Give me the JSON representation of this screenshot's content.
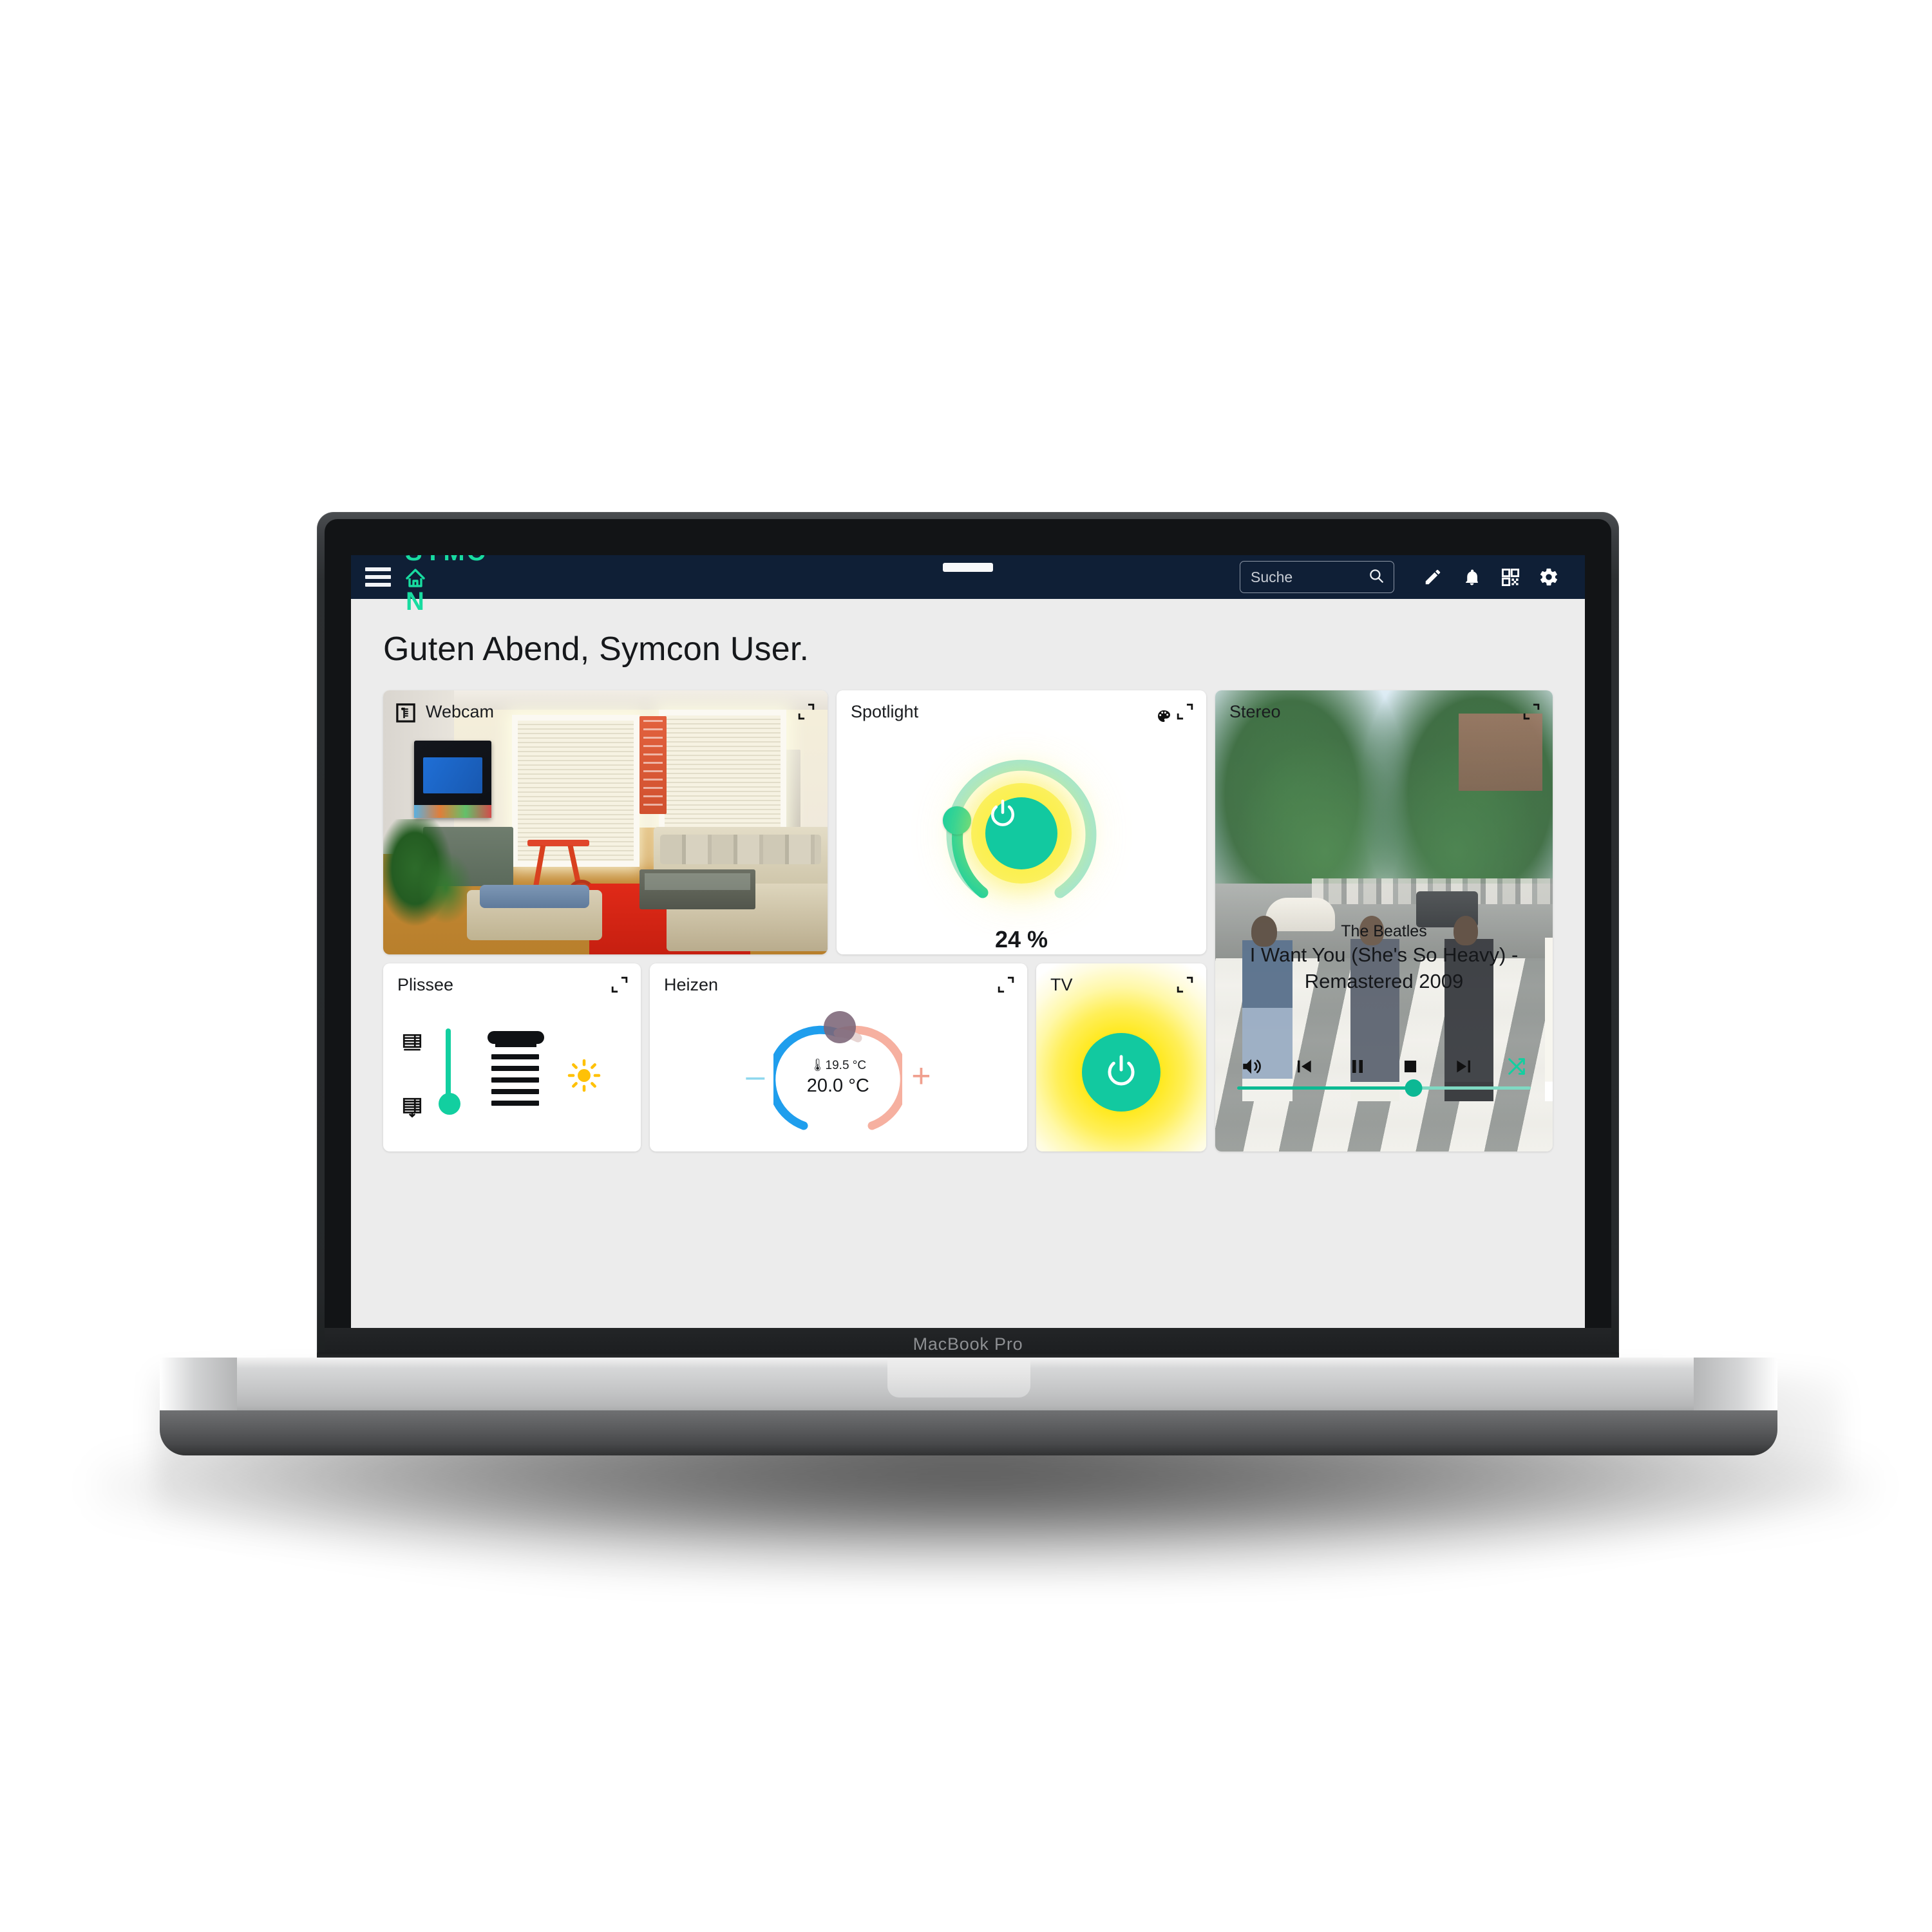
{
  "device": {
    "model_label": "MacBook Pro"
  },
  "appbar": {
    "brand": "SYMCON",
    "brand_color": "#18dca0",
    "bar_color": "#0f1f36",
    "menu_icon": "hamburger-menu-icon",
    "search": {
      "value": "",
      "placeholder": "Suche",
      "icon": "search-icon"
    },
    "actions": [
      {
        "name": "edit",
        "icon": "pencil-icon"
      },
      {
        "name": "notifications",
        "icon": "bell-icon"
      },
      {
        "name": "qr",
        "icon": "qr-code-icon"
      },
      {
        "name": "settings",
        "icon": "gear-icon"
      }
    ]
  },
  "page": {
    "greeting": "Guten Abend, Symcon User."
  },
  "cards": {
    "webcam": {
      "title": "Webcam",
      "icon": "camera-icon",
      "expand_icon": "expand-icon"
    },
    "spotlight": {
      "title": "Spotlight",
      "expand_icon": "expand-icon",
      "value_label": "24 %",
      "value_percent": 24,
      "power_icon": "power-icon",
      "color_icon": "palette-icon",
      "accent": "#12c9a0",
      "glow": "#ffe600"
    },
    "stereo": {
      "title": "Stereo",
      "expand_icon": "expand-icon",
      "artist": "The Beatles",
      "track": "I Want You (She's So Heavy) - Remastered 2009",
      "progress_percent": 60,
      "controls": [
        {
          "name": "volume",
          "icon": "volume-icon"
        },
        {
          "name": "previous",
          "icon": "skip-previous-icon"
        },
        {
          "name": "pause",
          "icon": "pause-icon"
        },
        {
          "name": "stop",
          "icon": "stop-icon"
        },
        {
          "name": "next",
          "icon": "skip-next-icon"
        },
        {
          "name": "shuffle",
          "icon": "shuffle-icon"
        }
      ]
    },
    "plissee": {
      "title": "Plissee",
      "expand_icon": "expand-icon",
      "up_icon": "blind-up-icon",
      "down_icon": "blind-down-icon",
      "sun_icon": "sun-icon",
      "slider_percent": 25
    },
    "heizen": {
      "title": "Heizen",
      "expand_icon": "expand-icon",
      "current_temperature": "19.5 °C",
      "current_icon": "thermometer-icon",
      "target_temperature": "20.0 °C",
      "decrease_label": "–",
      "increase_label": "+"
    },
    "tv": {
      "title": "TV",
      "expand_icon": "expand-icon",
      "power_icon": "power-icon",
      "state": "on"
    }
  }
}
